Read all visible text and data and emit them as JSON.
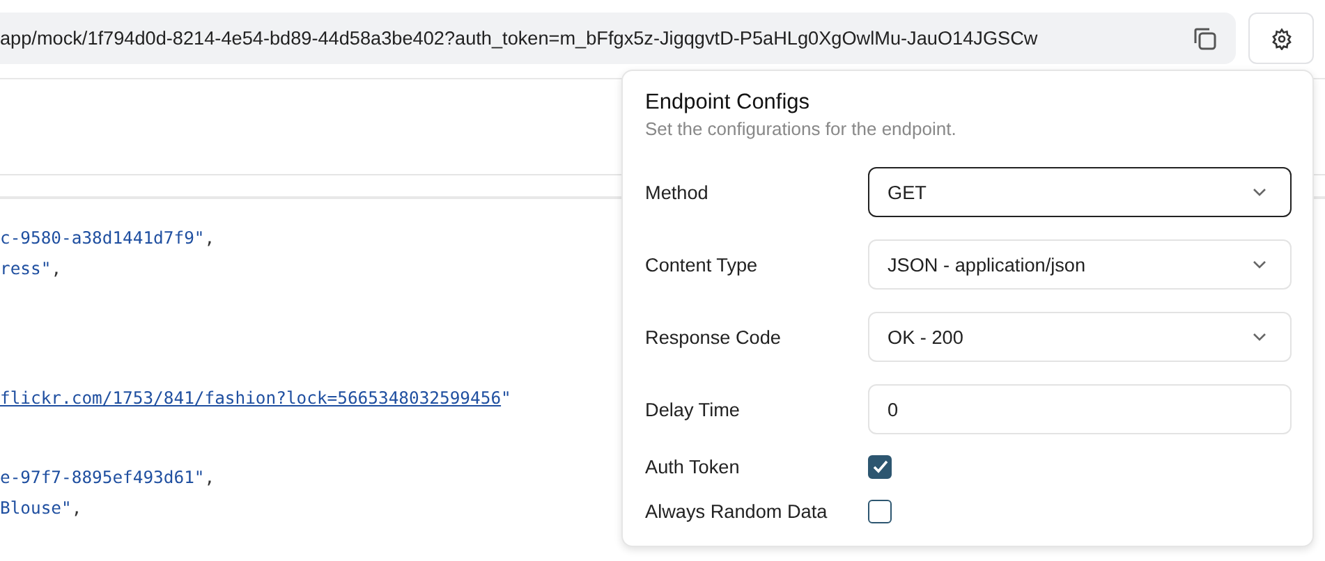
{
  "url_bar": {
    "url": "app/mock/1f794d0d-8214-4e54-bd89-44d58a3be402?auth_token=m_bFfgx5z-JigqgvtD-P5aHLg0XgOwlMu-JauO14JGSCw"
  },
  "code_blocks": [
    {
      "lines": [
        {
          "kind": "string",
          "value": "c-9580-a38d1441d7f9\"",
          "suffix": ","
        },
        {
          "kind": "string",
          "value": "ress\"",
          "suffix": ","
        }
      ]
    },
    {
      "lines": [
        {
          "kind": "link",
          "value": "flickr.com/1753/841/fashion?lock=5665348032599456",
          "suffix": "\""
        }
      ]
    },
    {
      "lines": [
        {
          "kind": "string",
          "value": "e-97f7-8895ef493d61\"",
          "suffix": ","
        },
        {
          "kind": "string",
          "value": "Blouse\"",
          "suffix": ","
        }
      ]
    }
  ],
  "popover": {
    "title": "Endpoint Configs",
    "subtitle": "Set the configurations for the endpoint.",
    "fields": [
      {
        "kind": "select",
        "label": "Method",
        "value": "GET",
        "focused": true
      },
      {
        "kind": "select",
        "label": "Content Type",
        "value": "JSON - application/json",
        "focused": false
      },
      {
        "kind": "select",
        "label": "Response Code",
        "value": "OK - 200",
        "focused": false
      },
      {
        "kind": "input",
        "label": "Delay Time",
        "value": "0",
        "focused": false
      },
      {
        "kind": "checkbox",
        "label": "Auth Token",
        "checked": true
      },
      {
        "kind": "checkbox",
        "label": "Always Random Data",
        "checked": false
      }
    ]
  }
}
